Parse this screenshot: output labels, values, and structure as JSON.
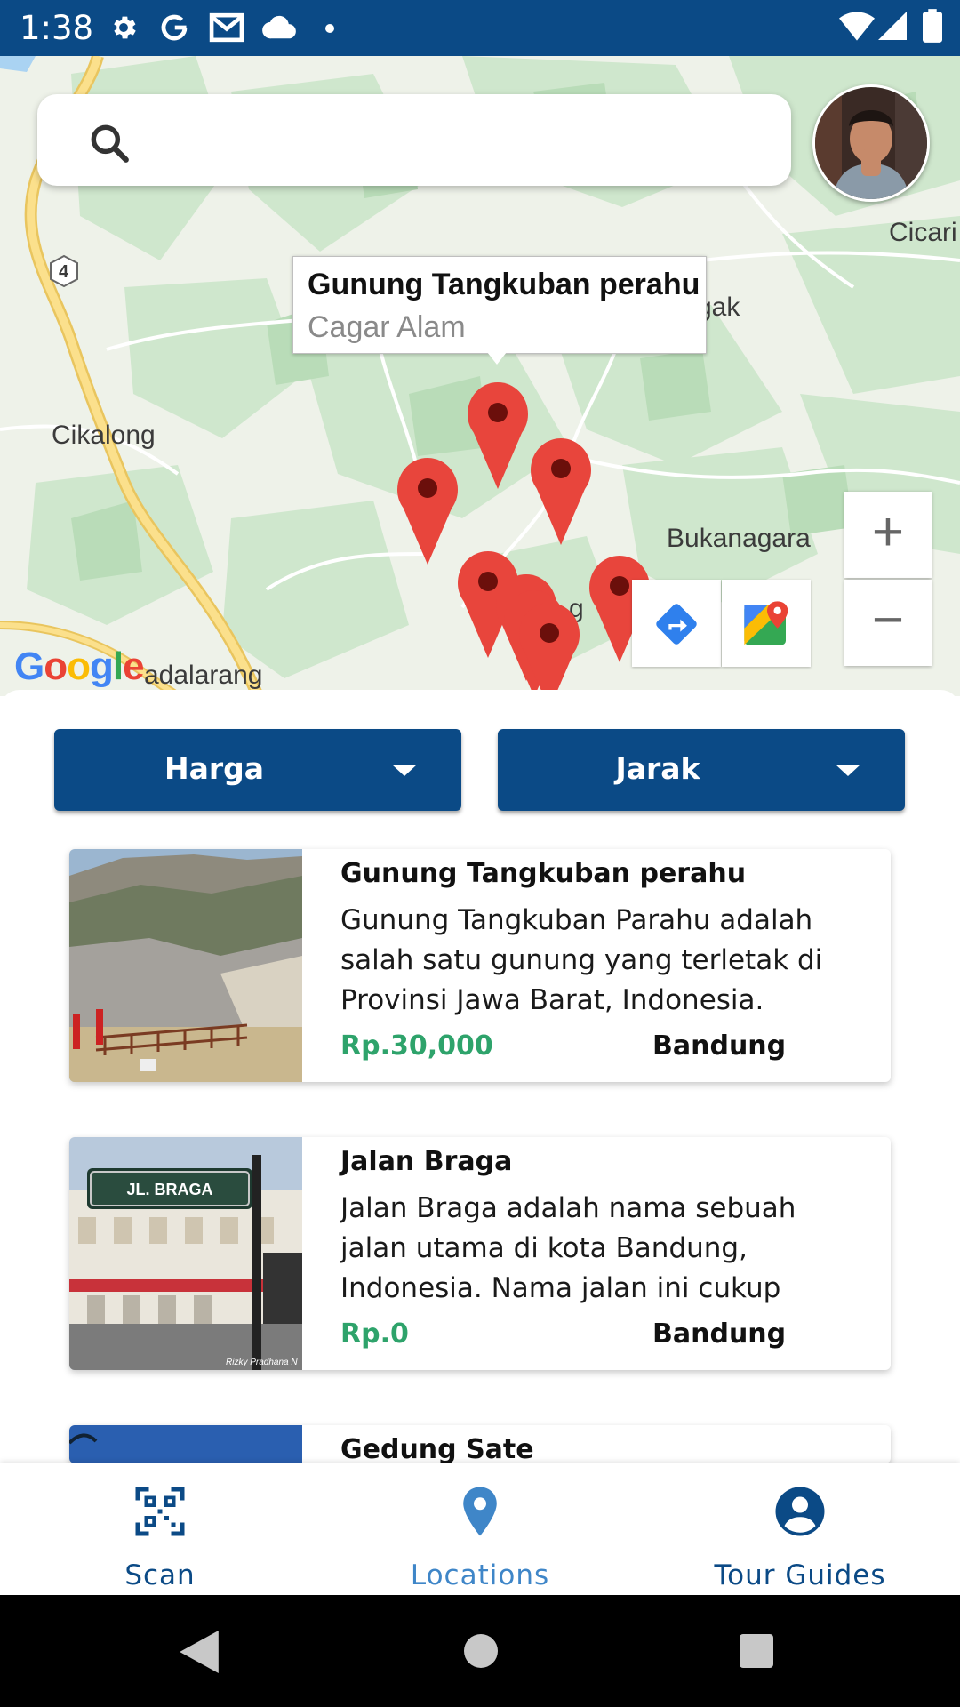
{
  "status_bar": {
    "time": "1:38",
    "icons": [
      "settings-icon",
      "google-icon",
      "gmail-icon",
      "cloud-icon",
      "dot-icon",
      "wifi-icon",
      "signal-icon",
      "battery-icon"
    ]
  },
  "map": {
    "search": {
      "placeholder": "",
      "icon": "search-icon"
    },
    "labels": {
      "cikalong": "Cikalong",
      "bukanagara": "Bukanagara",
      "cicari": "Cicari",
      "gak": "gak",
      "padalarang": "adalarang",
      "g_partial": "g",
      "highway": "4"
    },
    "google_logo": "Google",
    "info_window": {
      "title": "Gunung Tangkuban perahu",
      "subtitle": "Cagar Alam"
    },
    "zoom_in": "+",
    "zoom_out": "−",
    "marker_color": "#e8453c"
  },
  "filters": [
    {
      "label": "Harga"
    },
    {
      "label": "Jarak"
    }
  ],
  "cards": [
    {
      "title": "Gunung Tangkuban perahu",
      "description": "Gunung Tangkuban Parahu adalah salah satu gunung yang terletak di Provinsi Jawa Barat, Indonesia.",
      "price": "Rp.30,000",
      "city": "Bandung"
    },
    {
      "title": "Jalan Braga",
      "description": "Jalan Braga adalah nama sebuah jalan utama di kota Bandung, Indonesia. Nama jalan ini cukup",
      "price": "Rp.0",
      "city": "Bandung",
      "sign_text": "JL. BRAGA",
      "photo_credit": "Rizky Pradhana N"
    },
    {
      "title": "Gedung Sate"
    }
  ],
  "bottom_nav": [
    {
      "label": "Scan",
      "icon": "qr-scan-icon"
    },
    {
      "label": "Locations",
      "icon": "location-pin-icon"
    },
    {
      "label": "Tour Guides",
      "icon": "account-circle-icon"
    }
  ],
  "colors": {
    "primary": "#0b4a86",
    "price_green": "#2ea36b",
    "nav_active": "#0b4a86",
    "nav_inactive": "#3f86c8"
  }
}
